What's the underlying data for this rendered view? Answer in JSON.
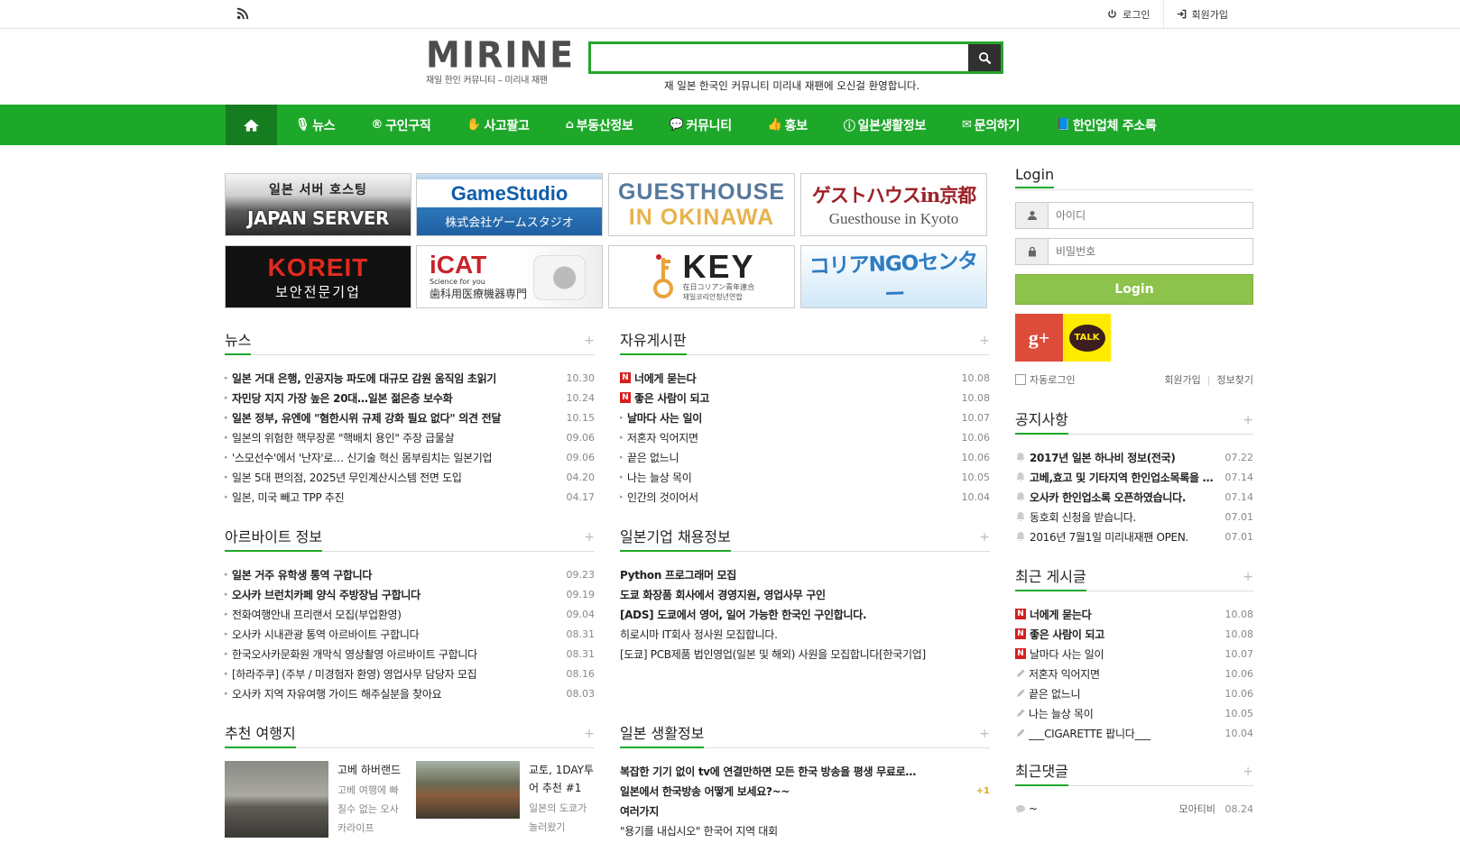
{
  "topbar": {
    "rss_icon": "rss-icon",
    "login_label": "로그인",
    "signup_label": "회원가입"
  },
  "header": {
    "logo_word": "MIRINE",
    "logo_sub": "재일 한인 커뮤니티 – 미리내 재팬",
    "search_placeholder": "",
    "welcome": "재 일본 한국인 커뮤니티 미리내 재팬에 오신걸 환영합니다."
  },
  "nav": {
    "home_icon": "home-icon",
    "items": [
      {
        "icon": "🎙",
        "label": "뉴스"
      },
      {
        "icon": "®",
        "label": "구인구직"
      },
      {
        "icon": "✋",
        "label": "사고팔고"
      },
      {
        "icon": "⌂",
        "label": "부동산정보"
      },
      {
        "icon": "💬",
        "label": "커뮤니티"
      },
      {
        "icon": "👍",
        "label": "홍보"
      },
      {
        "icon": "ⓘ",
        "label": "일본생활정보"
      },
      {
        "icon": "✉",
        "label": "문의하기"
      },
      {
        "icon": "📘",
        "label": "한인업체 주소록"
      }
    ]
  },
  "banners": {
    "b1": {
      "t1": "일본 서버 호스팅",
      "t2": "JAPAN SERVER"
    },
    "b2": {
      "t1": "GameStudio",
      "t2": "株式会社ゲームスタジオ"
    },
    "b3": {
      "t1": "GUESTHOUSE",
      "t2": "IN OKINAWA"
    },
    "b4": {
      "t1": "ゲストハウスin京都",
      "t2": "Guesthouse in Kyoto"
    },
    "b5": {
      "t1": "KOREIT",
      "t2": "보안전문기업"
    },
    "b6": {
      "t1": "iCAT",
      "t2": "Science for you",
      "t3": "歯科用医療機器専門"
    },
    "b7": {
      "t1": "KEY",
      "t2": "在日コリアン青年連合",
      "t3": "재일코리안청년연합"
    },
    "b8": {
      "t1": "コリアNGOセンター"
    }
  },
  "news": {
    "title": "뉴스",
    "plus": "+",
    "items": [
      {
        "text": "일본 거대 은행, 인공지능 파도에 대규모 감원 움직임 초읽기",
        "date": "10.30",
        "bold": true
      },
      {
        "text": "자민당 지지 가장 높은 20대…일본 젊은층 보수화",
        "date": "10.24",
        "bold": true
      },
      {
        "text": "일본 정부, 유엔에 \"혐한시위 규제 강화 필요 없다\" 의견 전달",
        "date": "10.15",
        "bold": true
      },
      {
        "text": "일본의 위험한 핵무장론 \"핵배치 용인\" 주장 급물살",
        "date": "09.06",
        "bold": false
      },
      {
        "text": "'스모선수'에서 '난자'로… 신기술 혁신 몸부림치는 일본기업",
        "date": "09.06",
        "bold": false
      },
      {
        "text": "일본 5대 편의점, 2025년 무인계산시스템 전면 도입",
        "date": "04.20",
        "bold": false
      },
      {
        "text": "일본, 미국 빼고 TPP 추진",
        "date": "04.17",
        "bold": false
      }
    ]
  },
  "free": {
    "title": "자유게시판",
    "plus": "+",
    "items": [
      {
        "text": "너에게 묻는다",
        "date": "10.08",
        "new": true,
        "bold": true
      },
      {
        "text": "좋은 사람이 되고",
        "date": "10.08",
        "new": true,
        "bold": true
      },
      {
        "text": "날마다 사는 일이",
        "date": "10.07",
        "new": false,
        "bold": true
      },
      {
        "text": "저혼자 익어지면",
        "date": "10.06",
        "new": false,
        "bold": false
      },
      {
        "text": "끝은 없느니",
        "date": "10.06",
        "new": false,
        "bold": false
      },
      {
        "text": "나는 늘상 목이",
        "date": "10.05",
        "new": false,
        "bold": false
      },
      {
        "text": "인간의 것이어서",
        "date": "10.04",
        "new": false,
        "bold": false
      }
    ],
    "new_badge": "N"
  },
  "albeit": {
    "title": "아르바이트 정보",
    "plus": "+",
    "items": [
      {
        "text": "일본 거주 유학생 통역 구합니다",
        "date": "09.23",
        "bold": true
      },
      {
        "text": "오사카 브런치카페 양식 주방장님 구합니다",
        "date": "09.19",
        "bold": true
      },
      {
        "text": "전화여행안내 프리랜서 모집(부업환영)",
        "date": "09.04",
        "bold": false
      },
      {
        "text": "오사카 시내관광 통역 아르바이트 구합니다",
        "date": "08.31",
        "bold": false
      },
      {
        "text": "한국오사카문화원 개막식 영상촬영 아르바이트 구합니다",
        "date": "08.31",
        "bold": false
      },
      {
        "text": "[하라주쿠] (주부 / 미경험자 환영) 영업사무 담당자 모집",
        "date": "08.16",
        "bold": false
      },
      {
        "text": "오사카 지역 자유여행 가이드 해주실분을 찾아요",
        "date": "08.03",
        "bold": false
      }
    ]
  },
  "jobs": {
    "title": "일본기업 채용정보",
    "plus": "+",
    "items": [
      {
        "text": "Python 프로그래머 모집",
        "bold": true
      },
      {
        "text": "도쿄 화장품 회사에서 경영지원, 영업사무 구인",
        "bold": true
      },
      {
        "text": "[ADS] 도쿄에서 영어, 일어 가능한 한국인 구인합니다.",
        "bold": true
      },
      {
        "text": "히로시마 IT회사 정사원 모집합니다.",
        "bold": false
      },
      {
        "text": "[도쿄] PCB제품 법인영업(일본 및 해외) 사원을 모집합니다[한국기업]",
        "bold": false
      }
    ]
  },
  "travel": {
    "title": "추천 여행지",
    "plus": "+",
    "items": [
      {
        "title": "고베 하버랜드",
        "desc": "고베 여행에 빠질수 없는 오사카라이프"
      },
      {
        "title": "교토, 1DAY투어 추천 #1",
        "desc": "일본의 도쿄가 놀러왔기"
      }
    ]
  },
  "life": {
    "title": "일본 생활정보",
    "plus": "+",
    "items": [
      {
        "text": "복잡한 기기 없이 tv에 연결만하면 모든 한국 방송을 평생 무료로…",
        "bold": true,
        "count": ""
      },
      {
        "text": "일본에서 한국방송 어떻게 보세요?~~",
        "bold": true,
        "count": "+1"
      },
      {
        "text": "여러가지",
        "bold": true,
        "count": ""
      },
      {
        "text": "\"용기를 내십시오\" 한국어 지역 대회",
        "bold": false,
        "count": ""
      }
    ]
  },
  "login": {
    "title": "Login",
    "id_placeholder": "아이디",
    "pw_placeholder": "비밀번호",
    "button": "Login",
    "gplus": "g+",
    "kakao": "TALK",
    "auto_login": "자동로그인",
    "signup": "회원가입",
    "find": "정보찾기",
    "sep": "|"
  },
  "notice": {
    "title": "공지사항",
    "plus": "+",
    "items": [
      {
        "text": "2017년 일본 하나비 정보(전국)",
        "date": "07.22",
        "bold": true
      },
      {
        "text": "고베,효고 및 기타지역 한인업소목록을 …",
        "date": "07.14",
        "bold": true
      },
      {
        "text": "오사카 한인업소록 오픈하였습니다.",
        "date": "07.14",
        "bold": true
      },
      {
        "text": "동호회 신청을 받습니다.",
        "date": "07.01",
        "bold": false
      },
      {
        "text": "2016년 7월1일 미리내재팬 OPEN.",
        "date": "07.01",
        "bold": false
      }
    ]
  },
  "recent": {
    "title": "최근 게시글",
    "plus": "+",
    "items": [
      {
        "text": "너에게 묻는다",
        "date": "10.08",
        "new": true,
        "bold": true
      },
      {
        "text": "좋은 사람이 되고",
        "date": "10.08",
        "new": true,
        "bold": true
      },
      {
        "text": "날마다 사는 일이",
        "date": "10.07",
        "new": true,
        "bold": false
      },
      {
        "text": "저혼자 익어지면",
        "date": "10.06",
        "new": false,
        "bold": false
      },
      {
        "text": "끝은 없느니",
        "date": "10.06",
        "new": false,
        "bold": false
      },
      {
        "text": "나는 늘상 목이",
        "date": "10.05",
        "new": false,
        "bold": false
      },
      {
        "text": "___CIGARETTE 팝니다___",
        "date": "10.04",
        "new": false,
        "bold": false
      }
    ]
  },
  "comments": {
    "title": "최근댓글",
    "plus": "+",
    "items": [
      {
        "text": "~",
        "author": "모아티비",
        "date": "08.24"
      }
    ]
  },
  "colors": {
    "brand_green": "#1ea82a",
    "home_dark_green": "#157d1f",
    "login_button": "#8dc24c",
    "new_badge": "#d81e1e"
  }
}
